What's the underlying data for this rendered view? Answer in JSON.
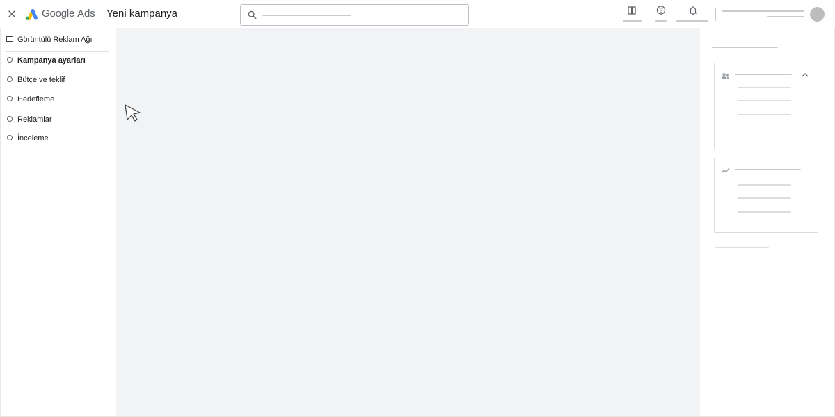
{
  "header": {
    "logo_word": "Google",
    "logo_suffix": "Ads",
    "page_title": "Yeni kampanya"
  },
  "sidebar": {
    "network_label": "Görüntülü Reklam Ağı",
    "steps": [
      {
        "label": "Kampanya ayarları",
        "active": true
      },
      {
        "label": "Bütçe ve teklif",
        "active": false
      },
      {
        "label": "Hedefleme",
        "active": false
      },
      {
        "label": "Reklamlar",
        "active": false
      },
      {
        "label": "İnceleme",
        "active": false
      }
    ]
  },
  "icons": {
    "close": "close-icon",
    "search": "search-icon",
    "store": "store-icon",
    "help": "help-icon",
    "notifications": "bell-icon",
    "audience": "people-icon",
    "trend": "trending-icon",
    "collapse": "chevron-up-icon",
    "cursor": "mouse-pointer-icon"
  },
  "colors": {
    "logo_blue": "#4285F4",
    "logo_yellow": "#FBBC04",
    "logo_green": "#34A853",
    "main_background": "#f1f3f4",
    "placeholder_gray": "#c8cacd",
    "avatar_gray": "#bdbdbd"
  }
}
